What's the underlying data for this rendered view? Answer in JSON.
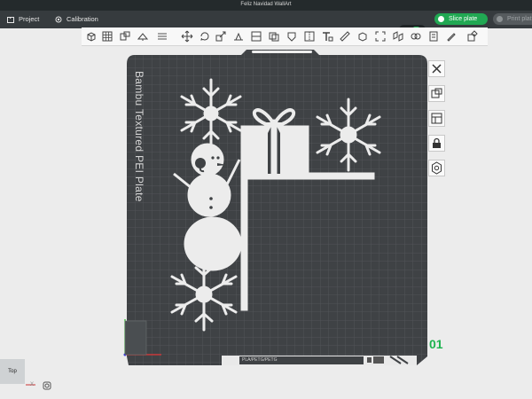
{
  "window": {
    "title": "Feliz Navidad WallArt"
  },
  "menu": {
    "project": "Project",
    "calibration": "Calibration"
  },
  "actions": {
    "slice": "Slice plate",
    "print": "Print plat"
  },
  "plate": {
    "name": "Bambu Textured PEI Plate",
    "number": "01",
    "filament_strip": "PLA/PETG/PETG"
  },
  "viewcube": {
    "face": "Top"
  },
  "axes": {
    "x": "X"
  },
  "colors": {
    "accent": "#21a853",
    "plate": "#3f4245",
    "grid": "#56595c",
    "model": "#ececec"
  }
}
